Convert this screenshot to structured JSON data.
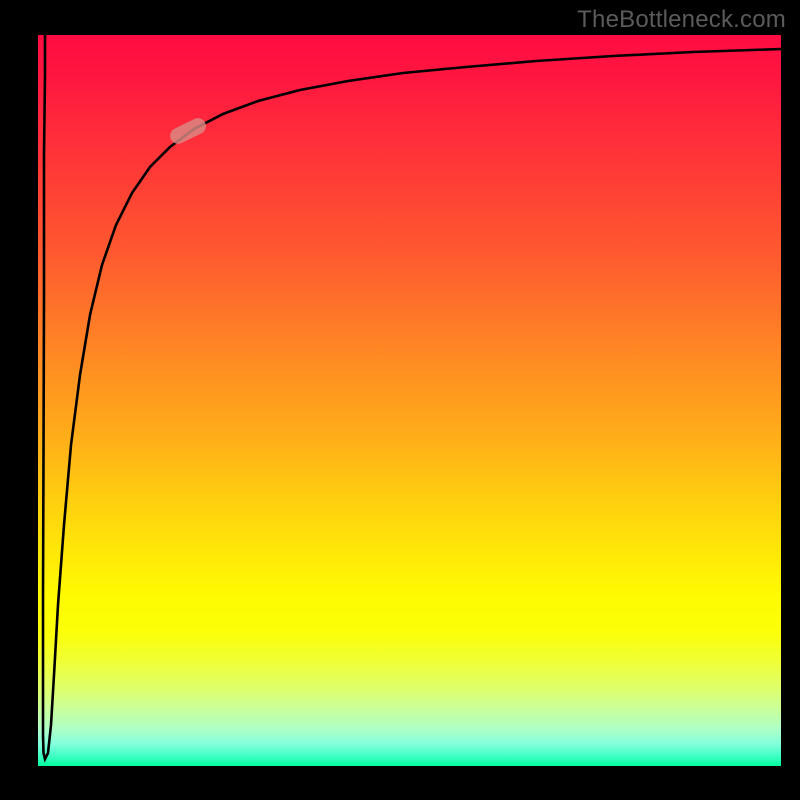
{
  "attribution": "TheBottleneck.com",
  "chart_data": {
    "type": "line",
    "title": "",
    "xlabel": "",
    "ylabel": "",
    "x_range": [
      0,
      100
    ],
    "y_range": [
      0,
      100
    ],
    "axes_visible": false,
    "grid": false,
    "legend": false,
    "background_gradient": {
      "direction": "vertical",
      "stops": [
        {
          "pos": 0.0,
          "color": "#ff0c42"
        },
        {
          "pos": 0.18,
          "color": "#ff3837"
        },
        {
          "pos": 0.42,
          "color": "#ff8325"
        },
        {
          "pos": 0.64,
          "color": "#ffd00f"
        },
        {
          "pos": 0.77,
          "color": "#fffb01"
        },
        {
          "pos": 0.9,
          "color": "#ddff6d"
        },
        {
          "pos": 0.97,
          "color": "#82ffdc"
        },
        {
          "pos": 1.0,
          "color": "#00ff9e"
        }
      ]
    },
    "series": [
      {
        "name": "bottleneck-curve",
        "x": [
          0.9,
          0.9,
          0.8,
          0.8,
          0.7,
          0.7,
          0.7,
          0.7,
          0.9,
          1.3,
          1.8,
          2.2,
          2.7,
          3.5,
          4.4,
          5.7,
          7.0,
          8.6,
          10.5,
          12.7,
          15.1,
          17.8,
          21.0,
          24.9,
          29.6,
          35.3,
          41.7,
          49.1,
          57.6,
          67.0,
          77.4,
          88.2,
          100.0
        ],
        "values": [
          100.0,
          94.5,
          83.6,
          64.4,
          42.5,
          23.4,
          12.4,
          4.2,
          1.8,
          0.9,
          5.6,
          12.4,
          22.0,
          33.0,
          43.9,
          53.5,
          61.7,
          68.5,
          74.0,
          78.4,
          81.9,
          84.7,
          87.1,
          89.2,
          91.0,
          92.5,
          93.7,
          94.8,
          95.6,
          96.4,
          97.1,
          97.7,
          98.1
        ]
      }
    ],
    "annotations": [
      {
        "type": "marker",
        "shape": "rounded-pill",
        "x": 20.2,
        "y": 86.6,
        "rotation_deg": -26,
        "color": "#db8a85",
        "opacity": 0.82
      }
    ]
  }
}
